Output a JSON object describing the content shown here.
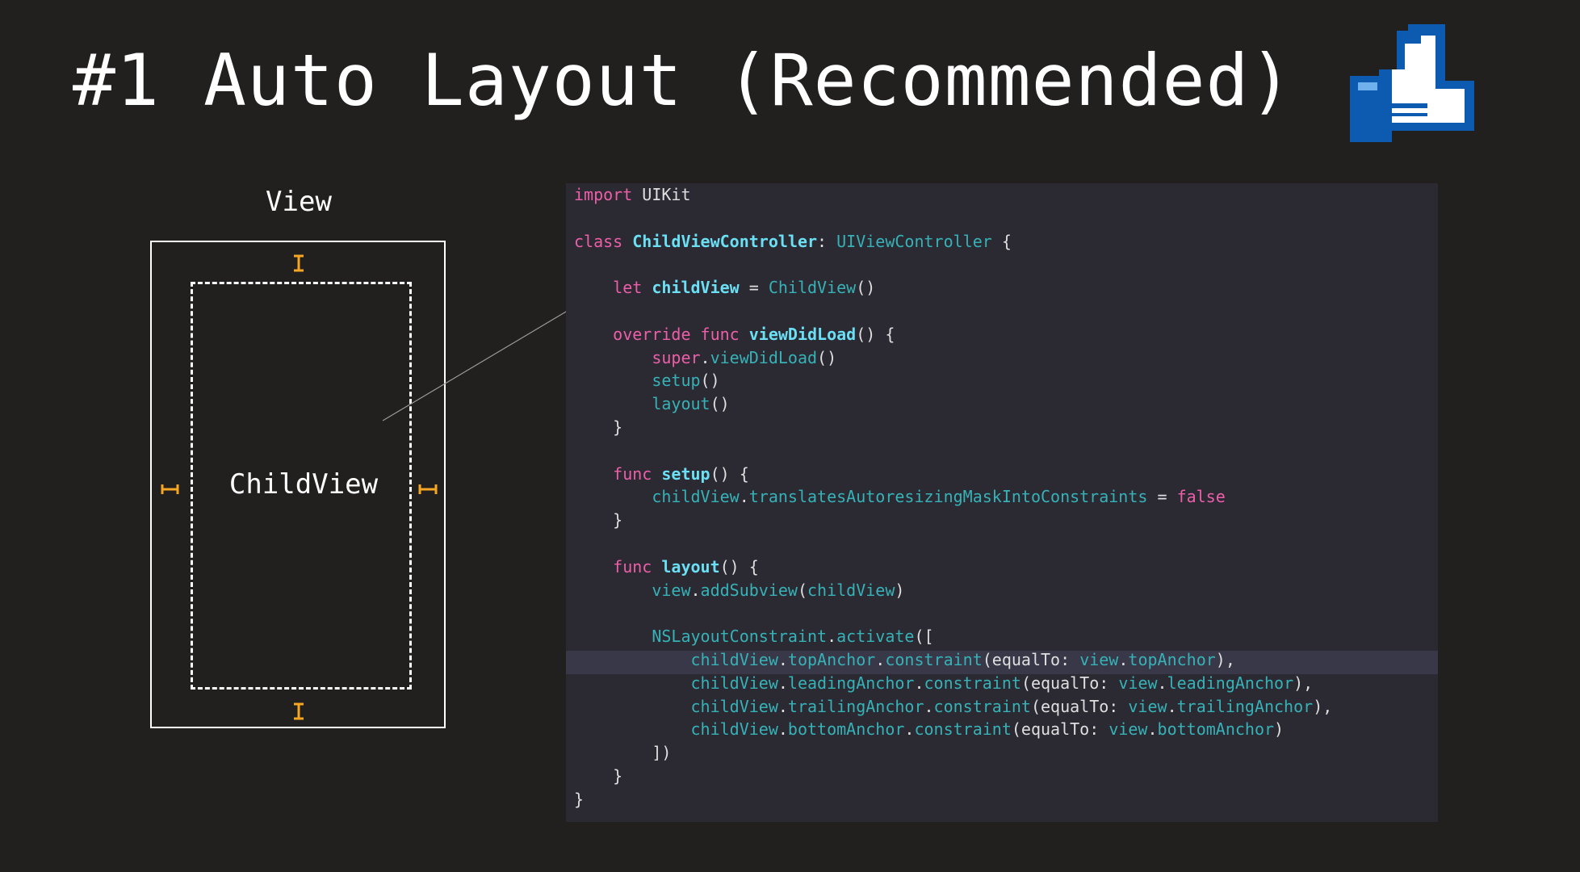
{
  "slide": {
    "title": "#1 Auto Layout (Recommended)",
    "thumb_icon": "thumbs-up-icon"
  },
  "diagram": {
    "view_label": "View",
    "child_label": "ChildView",
    "colors": {
      "stroke": "#ffffff",
      "constraint": "#f5a623",
      "connector": "#9a9a9a"
    },
    "constraint_icons": [
      "top-constraint-icon",
      "bottom-constraint-icon",
      "leading-constraint-icon",
      "trailing-constraint-icon"
    ]
  },
  "code": {
    "colors": {
      "background": "#2b2a33",
      "highlight": "#383848",
      "keyword": "#ec5fa8",
      "declaration": "#6bdff3",
      "type": "#36b2b7",
      "plain": "#dfdfe0"
    },
    "highlighted_line": 20,
    "lines": [
      [
        {
          "t": "kw",
          "v": "import"
        },
        {
          "t": "plain",
          "v": " UIKit"
        }
      ],
      [],
      [
        {
          "t": "kw",
          "v": "class"
        },
        {
          "t": "plain",
          "v": " "
        },
        {
          "t": "decl",
          "v": "ChildViewController"
        },
        {
          "t": "plain",
          "v": ": "
        },
        {
          "t": "type",
          "v": "UIViewController"
        },
        {
          "t": "plain",
          "v": " {"
        }
      ],
      [],
      [
        {
          "t": "plain",
          "v": "    "
        },
        {
          "t": "kw",
          "v": "let"
        },
        {
          "t": "plain",
          "v": " "
        },
        {
          "t": "decl",
          "v": "childView"
        },
        {
          "t": "plain",
          "v": " = "
        },
        {
          "t": "type",
          "v": "ChildView"
        },
        {
          "t": "plain",
          "v": "()"
        }
      ],
      [],
      [
        {
          "t": "plain",
          "v": "    "
        },
        {
          "t": "kw",
          "v": "override"
        },
        {
          "t": "plain",
          "v": " "
        },
        {
          "t": "kw",
          "v": "func"
        },
        {
          "t": "plain",
          "v": " "
        },
        {
          "t": "decl",
          "v": "viewDidLoad"
        },
        {
          "t": "plain",
          "v": "() {"
        }
      ],
      [
        {
          "t": "plain",
          "v": "        "
        },
        {
          "t": "kw",
          "v": "super"
        },
        {
          "t": "plain",
          "v": "."
        },
        {
          "t": "fn",
          "v": "viewDidLoad"
        },
        {
          "t": "plain",
          "v": "()"
        }
      ],
      [
        {
          "t": "plain",
          "v": "        "
        },
        {
          "t": "fn",
          "v": "setup"
        },
        {
          "t": "plain",
          "v": "()"
        }
      ],
      [
        {
          "t": "plain",
          "v": "        "
        },
        {
          "t": "fn",
          "v": "layout"
        },
        {
          "t": "plain",
          "v": "()"
        }
      ],
      [
        {
          "t": "plain",
          "v": "    }"
        }
      ],
      [],
      [
        {
          "t": "plain",
          "v": "    "
        },
        {
          "t": "kw",
          "v": "func"
        },
        {
          "t": "plain",
          "v": " "
        },
        {
          "t": "decl",
          "v": "setup"
        },
        {
          "t": "plain",
          "v": "() {"
        }
      ],
      [
        {
          "t": "plain",
          "v": "        "
        },
        {
          "t": "prop",
          "v": "childView"
        },
        {
          "t": "plain",
          "v": "."
        },
        {
          "t": "prop",
          "v": "translatesAutoresizingMaskIntoConstraints"
        },
        {
          "t": "plain",
          "v": " = "
        },
        {
          "t": "kw",
          "v": "false"
        }
      ],
      [
        {
          "t": "plain",
          "v": "    }"
        }
      ],
      [],
      [
        {
          "t": "plain",
          "v": "    "
        },
        {
          "t": "kw",
          "v": "func"
        },
        {
          "t": "plain",
          "v": " "
        },
        {
          "t": "decl",
          "v": "layout"
        },
        {
          "t": "plain",
          "v": "() {"
        }
      ],
      [
        {
          "t": "plain",
          "v": "        "
        },
        {
          "t": "prop",
          "v": "view"
        },
        {
          "t": "plain",
          "v": "."
        },
        {
          "t": "fn",
          "v": "addSubview"
        },
        {
          "t": "plain",
          "v": "("
        },
        {
          "t": "prop",
          "v": "childView"
        },
        {
          "t": "plain",
          "v": ")"
        }
      ],
      [],
      [
        {
          "t": "plain",
          "v": "        "
        },
        {
          "t": "type",
          "v": "NSLayoutConstraint"
        },
        {
          "t": "plain",
          "v": "."
        },
        {
          "t": "fn",
          "v": "activate"
        },
        {
          "t": "plain",
          "v": "(["
        }
      ],
      [
        {
          "t": "plain",
          "v": "            "
        },
        {
          "t": "prop",
          "v": "childView"
        },
        {
          "t": "plain",
          "v": "."
        },
        {
          "t": "prop",
          "v": "topAnchor"
        },
        {
          "t": "plain",
          "v": "."
        },
        {
          "t": "fn",
          "v": "constraint"
        },
        {
          "t": "plain",
          "v": "(equalTo: "
        },
        {
          "t": "prop",
          "v": "view"
        },
        {
          "t": "plain",
          "v": "."
        },
        {
          "t": "prop",
          "v": "topAnchor"
        },
        {
          "t": "plain",
          "v": "),"
        }
      ],
      [
        {
          "t": "plain",
          "v": "            "
        },
        {
          "t": "prop",
          "v": "childView"
        },
        {
          "t": "plain",
          "v": "."
        },
        {
          "t": "prop",
          "v": "leadingAnchor"
        },
        {
          "t": "plain",
          "v": "."
        },
        {
          "t": "fn",
          "v": "constraint"
        },
        {
          "t": "plain",
          "v": "(equalTo: "
        },
        {
          "t": "prop",
          "v": "view"
        },
        {
          "t": "plain",
          "v": "."
        },
        {
          "t": "prop",
          "v": "leadingAnchor"
        },
        {
          "t": "plain",
          "v": "),"
        }
      ],
      [
        {
          "t": "plain",
          "v": "            "
        },
        {
          "t": "prop",
          "v": "childView"
        },
        {
          "t": "plain",
          "v": "."
        },
        {
          "t": "prop",
          "v": "trailingAnchor"
        },
        {
          "t": "plain",
          "v": "."
        },
        {
          "t": "fn",
          "v": "constraint"
        },
        {
          "t": "plain",
          "v": "(equalTo: "
        },
        {
          "t": "prop",
          "v": "view"
        },
        {
          "t": "plain",
          "v": "."
        },
        {
          "t": "prop",
          "v": "trailingAnchor"
        },
        {
          "t": "plain",
          "v": "),"
        }
      ],
      [
        {
          "t": "plain",
          "v": "            "
        },
        {
          "t": "prop",
          "v": "childView"
        },
        {
          "t": "plain",
          "v": "."
        },
        {
          "t": "prop",
          "v": "bottomAnchor"
        },
        {
          "t": "plain",
          "v": "."
        },
        {
          "t": "fn",
          "v": "constraint"
        },
        {
          "t": "plain",
          "v": "(equalTo: "
        },
        {
          "t": "prop",
          "v": "view"
        },
        {
          "t": "plain",
          "v": "."
        },
        {
          "t": "prop",
          "v": "bottomAnchor"
        },
        {
          "t": "plain",
          "v": ")"
        }
      ],
      [
        {
          "t": "plain",
          "v": "        ])"
        }
      ],
      [
        {
          "t": "plain",
          "v": "    }"
        }
      ],
      [
        {
          "t": "plain",
          "v": "}"
        }
      ]
    ]
  }
}
